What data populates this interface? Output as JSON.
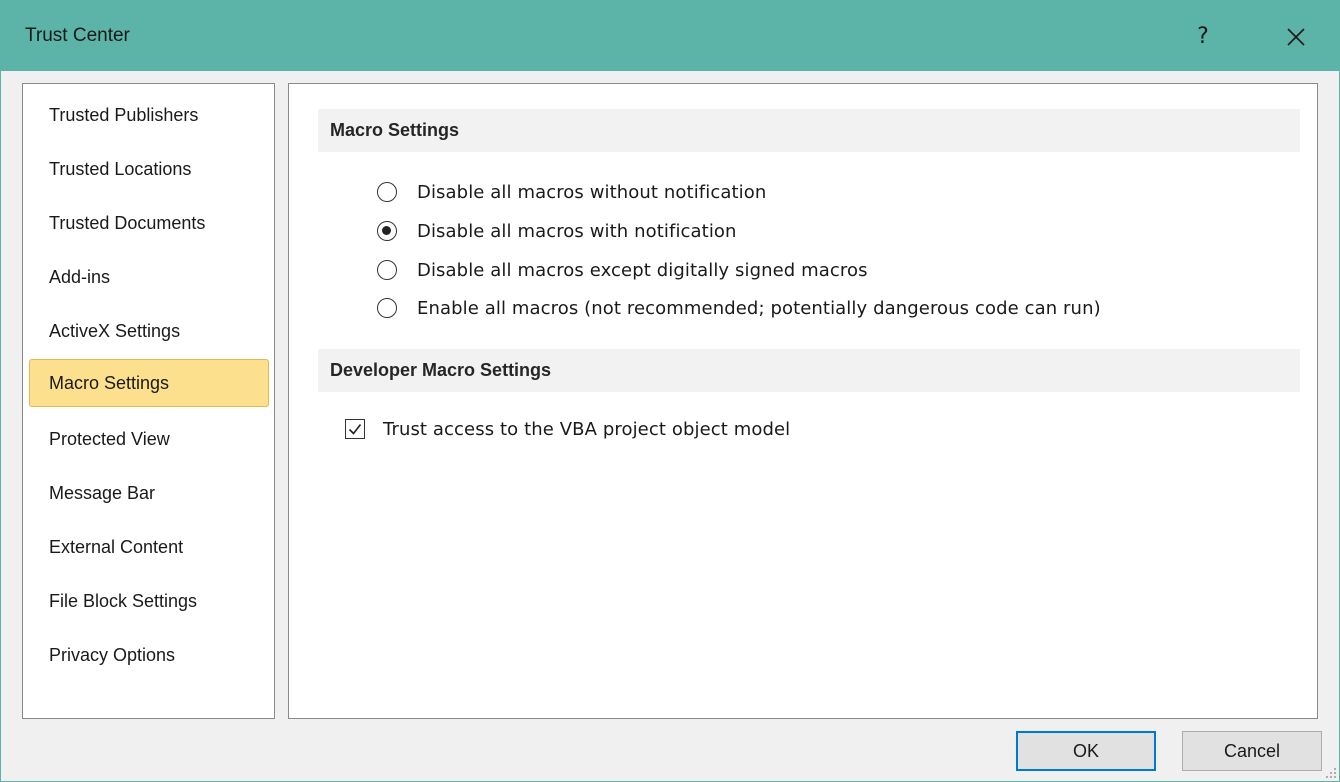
{
  "window": {
    "title": "Trust Center",
    "help_label": "?",
    "close_icon": "close-icon"
  },
  "sidebar": {
    "items": [
      {
        "label": "Trusted Publishers"
      },
      {
        "label": "Trusted Locations"
      },
      {
        "label": "Trusted Documents"
      },
      {
        "label": "Add-ins"
      },
      {
        "label": "ActiveX Settings"
      },
      {
        "label": "Macro Settings",
        "selected": true
      },
      {
        "label": "Protected View"
      },
      {
        "label": "Message Bar"
      },
      {
        "label": "External Content"
      },
      {
        "label": "File Block Settings"
      },
      {
        "label": "Privacy Options"
      }
    ]
  },
  "macro_settings": {
    "header": "Macro Settings",
    "options": [
      {
        "label": "Disable all macros without notification",
        "checked": false
      },
      {
        "label": "Disable all macros with notification",
        "checked": true
      },
      {
        "label": "Disable all macros except digitally signed macros",
        "checked": false
      },
      {
        "label": "Enable all macros (not recommended; potentially dangerous code can run)",
        "checked": false
      }
    ]
  },
  "developer_settings": {
    "header": "Developer Macro Settings",
    "trust_vba_label": "Trust access to the VBA project object model",
    "trust_vba_checked": true
  },
  "footer": {
    "ok_label": "OK",
    "cancel_label": "Cancel"
  },
  "colors": {
    "titlebar": "#5cb3a8",
    "selected_item": "#fde08d",
    "primary_border": "#0078d7"
  }
}
